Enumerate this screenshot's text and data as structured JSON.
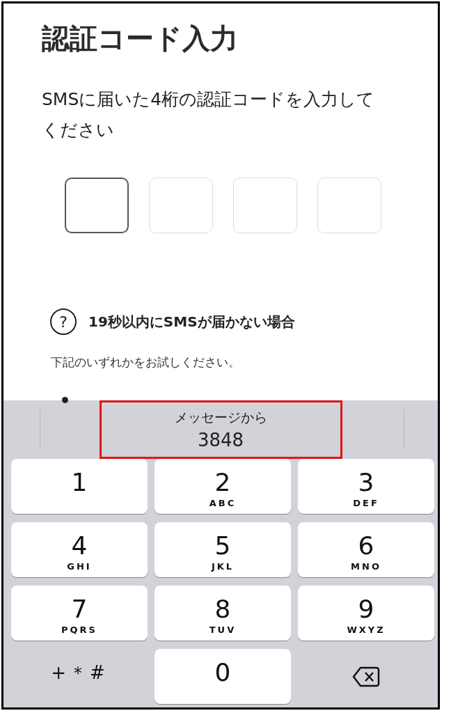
{
  "title": "認証コード入力",
  "description": "SMSに届いた4桁の認証コードを入力してください",
  "code_boxes": [
    {
      "selected": true
    },
    {
      "selected": false
    },
    {
      "selected": false
    },
    {
      "selected": false
    }
  ],
  "help": {
    "icon": "?",
    "heading": "19秒以内にSMSが届かない場合",
    "text": "下記のいずれかをお試しください。"
  },
  "keyboard": {
    "suggestion": {
      "label": "メッセージから",
      "code": "3848"
    },
    "keys": [
      {
        "kind": "digit",
        "digit": "1"
      },
      {
        "kind": "digit",
        "digit": "2",
        "letters": "ABC"
      },
      {
        "kind": "digit",
        "digit": "3",
        "letters": "DEF"
      },
      {
        "kind": "digit",
        "digit": "4",
        "letters": "GHI"
      },
      {
        "kind": "digit",
        "digit": "5",
        "letters": "JKL"
      },
      {
        "kind": "digit",
        "digit": "6",
        "letters": "MNO"
      },
      {
        "kind": "digit",
        "digit": "7",
        "letters": "PQRS"
      },
      {
        "kind": "digit",
        "digit": "8",
        "letters": "TUV"
      },
      {
        "kind": "digit",
        "digit": "9",
        "letters": "WXYZ"
      },
      {
        "kind": "symbols",
        "digit": "+＊#"
      },
      {
        "kind": "digit",
        "digit": "0"
      },
      {
        "kind": "delete"
      }
    ]
  }
}
